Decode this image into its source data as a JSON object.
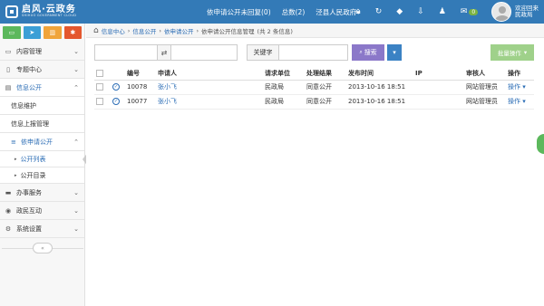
{
  "header": {
    "logo_title": "启风·云政务",
    "logo_subtitle": "SHIHUO GOVERNMENT CLOUD",
    "pending_text": "依申请公开未回复(0)",
    "total_text": "总数(2)",
    "dept_text": "泾县人民政府",
    "dept_caret": "▾",
    "icons": [
      "home-icon",
      "refresh-icon",
      "tags-icon",
      "download-icon",
      "user-icon",
      "mail-icon"
    ],
    "mail_badge": "0",
    "user_welcome": "欢迎回来",
    "user_dept": "民政局"
  },
  "sidebar": {
    "shortcuts": [
      {
        "icon": "monitor-icon",
        "color": "#5cb85c",
        "glyph": "▭"
      },
      {
        "icon": "send-icon",
        "color": "#3b9fd6",
        "glyph": "➤"
      },
      {
        "icon": "chart-icon",
        "color": "#f0a43a",
        "glyph": "▥"
      },
      {
        "icon": "settings-icon",
        "color": "#e4572e",
        "glyph": "✱"
      }
    ],
    "items": [
      {
        "label": "内容管理",
        "icon": "▭"
      },
      {
        "label": "专题中心",
        "icon": "▯"
      },
      {
        "label": "信息公开",
        "icon": "▤"
      }
    ],
    "subs": [
      {
        "label": "信息维护"
      },
      {
        "label": "信息上报管理"
      },
      {
        "label": "依申请公开"
      }
    ],
    "subs2": [
      {
        "label": "公开列表"
      },
      {
        "label": "公开目录"
      }
    ],
    "items2": [
      {
        "label": "办事服务",
        "icon": "▬"
      },
      {
        "label": "政民互动",
        "icon": "◉"
      },
      {
        "label": "系统设置",
        "icon": "⚙"
      }
    ],
    "collapse_glyph": "«"
  },
  "breadcrumb": {
    "home_icon": "⌂",
    "items": [
      "信息中心",
      "信息公开",
      "依申请公开",
      "依申请公开信息管理"
    ],
    "count_text": "(共 2 条信息)",
    "sep": "›"
  },
  "toolbar": {
    "swap_glyph": "⇄",
    "keyword_label": "关键字",
    "search_label": "搜索",
    "search_icon": "🔍",
    "batch_label": "批量操作",
    "caret": "▾"
  },
  "table": {
    "headers": [
      "",
      "",
      "编号",
      "申请人",
      "请求单位",
      "处理结果",
      "发布时间",
      "IP",
      "审核人",
      "操作"
    ],
    "rows": [
      {
        "id": "10078",
        "applicant": "张小飞",
        "unit": "民政局",
        "result": "同意公开",
        "time": "2013-10-16 18:51",
        "ip": "",
        "reviewer": "网站管理员",
        "op": "操作"
      },
      {
        "id": "10077",
        "applicant": "张小飞",
        "unit": "民政局",
        "result": "同意公开",
        "time": "2013-10-16 18:51",
        "ip": "",
        "reviewer": "网站管理员",
        "op": "操作"
      }
    ]
  }
}
